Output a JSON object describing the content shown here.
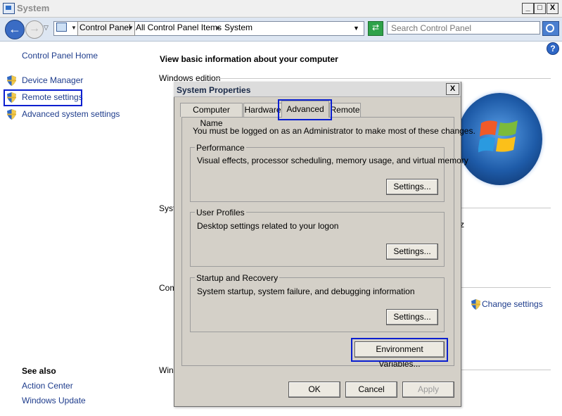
{
  "window": {
    "title": "System",
    "controls": {
      "minimize": "_",
      "maximize": "□",
      "close": "X"
    }
  },
  "address_bar": {
    "crumbs": [
      "Control Panel",
      "All Control Panel Items",
      "System"
    ],
    "search_placeholder": "Search Control Panel"
  },
  "sidebar": {
    "home": "Control Panel Home",
    "tasks": [
      "Device Manager",
      "Remote settings",
      "Advanced system settings"
    ],
    "see_also_title": "See also",
    "see_also": [
      "Action Center",
      "Windows Update"
    ]
  },
  "main": {
    "heading": "View basic information about your computer",
    "sections": [
      "Windows edition",
      "Syst",
      "Com",
      "Wind"
    ],
    "clipped_fragment": "z",
    "change_settings": "Change settings",
    "help": "?"
  },
  "dialog": {
    "title": "System Properties",
    "close": "X",
    "tabs": [
      "Computer Name",
      "Hardware",
      "Advanced",
      "Remote"
    ],
    "active_tab": "Advanced",
    "admin_note": "You must be logged on as an Administrator to make most of these changes.",
    "groups": [
      {
        "title": "Performance",
        "desc": "Visual effects, processor scheduling, memory usage, and virtual memory",
        "button": "Settings..."
      },
      {
        "title": "User Profiles",
        "desc": "Desktop settings related to your logon",
        "button": "Settings..."
      },
      {
        "title": "Startup and Recovery",
        "desc": "System startup, system failure, and debugging information",
        "button": "Settings..."
      }
    ],
    "env_button": "Environment Variables...",
    "footer": {
      "ok": "OK",
      "cancel": "Cancel",
      "apply": "Apply"
    }
  },
  "colors": {
    "highlight_box": "#0a1fd0",
    "link": "#1e3c8c",
    "dialog_face": "#d4d0c8"
  }
}
